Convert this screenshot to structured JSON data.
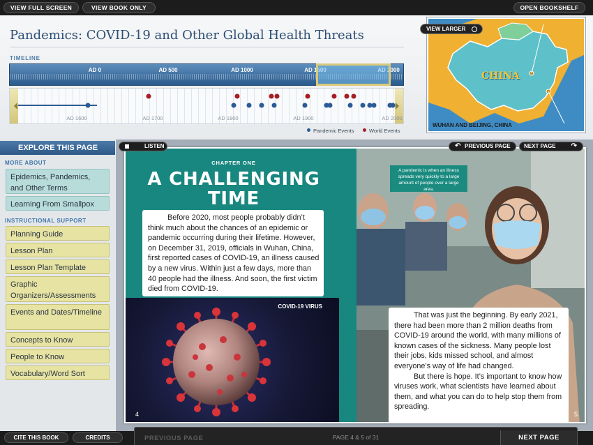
{
  "top_bar": {
    "view_full_screen": "VIEW FULL SCREEN",
    "view_book_only": "VIEW BOOK ONLY",
    "open_bookshelf": "OPEN BOOKSHELF"
  },
  "page_title": "Pandemics: COVID-19 and Other Global Health Threats",
  "timeline": {
    "label": "TIMELINE",
    "top_years": [
      "AD 0",
      "AD 500",
      "AD 1000",
      "AD 1500",
      "AD 2000"
    ],
    "bottom_years": [
      "AD 1600",
      "AD 1700",
      "AD 1800",
      "AD 1900",
      "AD 2000"
    ],
    "legend": {
      "pandemic": "Pandemic Events",
      "world": "World Events"
    },
    "colors": {
      "pandemic": "#2b5b97",
      "world": "#a51e24"
    }
  },
  "map": {
    "view_larger": "VIEW LARGER",
    "country_label": "CHINA",
    "caption": "WUHAN AND BEIJING, CHINA"
  },
  "sidebar": {
    "explore": "EXPLORE THIS PAGE",
    "more_about_label": "MORE ABOUT",
    "more_about": [
      "Epidemics, Pandemics, and Other Terms",
      "Learning From Smallpox"
    ],
    "instructional_label": "INSTRUCTIONAL SUPPORT",
    "instructional": [
      "Planning Guide",
      "Lesson Plan",
      "Lesson Plan Template",
      "Graphic Organizers/Assessments",
      "Events and Dates/Timeline",
      "Concepts to Know",
      "People to Know",
      "Vocabulary/Word Sort"
    ]
  },
  "book_controls": {
    "listen": "LISTEN",
    "previous_page": "PREVIOUS PAGE",
    "next_page": "NEXT PAGE"
  },
  "book": {
    "chapter": "CHAPTER ONE",
    "headline_1": "A CHALLENGING",
    "headline_2": "TIME",
    "paragraph_1": "Before 2020, most people probably didn’t think much about the chances of an epidemic or pandemic occurring during their lifetime. However, on December 31, 2019, officials in Wuhan, China, first reported cases of COVID-19, an illness caused by a new virus. Within just a few days, more than 40 people had the illness. And soon, the first victim died from COVID-19.",
    "virus_label": "COVID-19 VIRUS",
    "page_left": "4",
    "callout": "A pandemic is when an illness spreads very quickly to a large amount of people over a large area.",
    "paragraph_2": "That was just the beginning. By early 2021, there had been more than 2 million deaths from COVID-19 around the world, with many millions of known cases of the sickness. Many people lost their jobs, kids missed school, and almost everyone’s way of life had changed.",
    "paragraph_3": "But there is hope. It’s important to know how viruses work, what scientists have learned about them, and what you can do to help stop them from spreading.",
    "page_right": "5"
  },
  "bottom_bar": {
    "cite": "CITE THIS BOOK",
    "credits": "CREDITS",
    "previous_page": "PREVIOUS PAGE",
    "page_info": "PAGE 4 & 5 of 31",
    "next_page": "NEXT PAGE"
  }
}
